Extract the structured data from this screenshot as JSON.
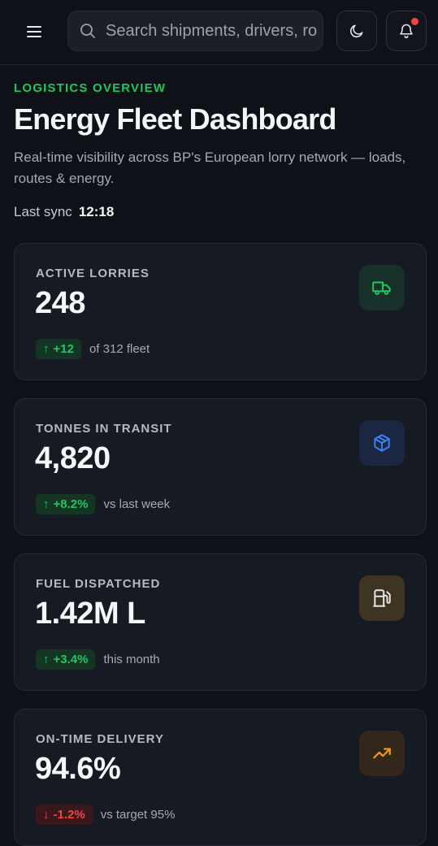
{
  "topbar": {
    "search_placeholder": "Search shipments, drivers, routes…",
    "notification_dot_color": "#ef4444"
  },
  "header": {
    "eyebrow": "LOGISTICS OVERVIEW",
    "title": "Energy Fleet Dashboard",
    "subtitle": "Real-time visibility across BP's European lorry network — loads, routes & energy.",
    "sync_label": "Last sync",
    "sync_time": "12:18"
  },
  "cards": [
    {
      "label": "ACTIVE LORRIES",
      "value": "248",
      "delta": "+12",
      "direction": "up",
      "foot": "of 312 fleet",
      "icon": "truck-icon",
      "icon_color": "#22c55e",
      "icon_bg": "#17302a"
    },
    {
      "label": "TONNES IN TRANSIT",
      "value": "4,820",
      "delta": "+8.2%",
      "direction": "up",
      "foot": "vs last week",
      "icon": "package-icon",
      "icon_color": "#3b82f6",
      "icon_bg": "#1b2740"
    },
    {
      "label": "FUEL DISPATCHED",
      "value": "1.42M L",
      "delta": "+3.4%",
      "direction": "up",
      "foot": "this month",
      "icon": "fuel-icon",
      "icon_color": "#e5e7eb",
      "icon_bg": "#3d3521"
    },
    {
      "label": "ON-TIME DELIVERY",
      "value": "94.6%",
      "delta": "-1.2%",
      "direction": "down",
      "foot": "vs target 95%",
      "icon": "trending-up-icon",
      "icon_color": "#f59e0b",
      "icon_bg": "#33261d"
    }
  ]
}
